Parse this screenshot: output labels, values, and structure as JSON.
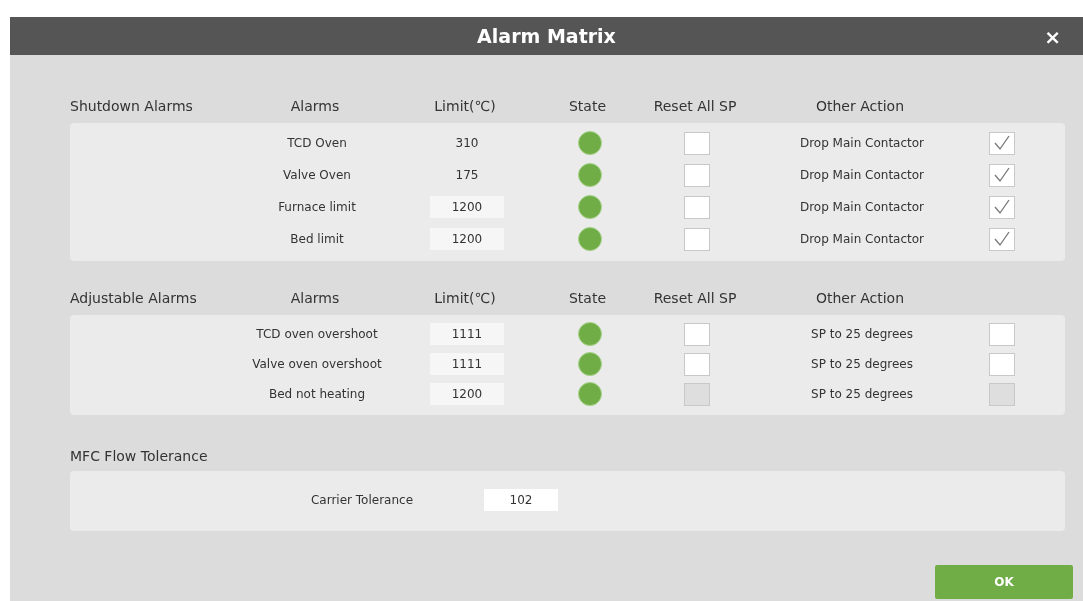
{
  "window": {
    "title": "Alarm Matrix",
    "close": "×"
  },
  "sections": [
    {
      "title": "Shutdown Alarms",
      "columns": [
        "Alarms",
        "Limit(℃)",
        "State",
        "Reset All SP",
        "Other Action"
      ],
      "rows": [
        {
          "alarm": "TCD Oven",
          "limit": {
            "kind": "text",
            "value": "310"
          },
          "on": true,
          "reset": {
            "checked": false,
            "disabled": false
          },
          "action": "Drop Main Contactor",
          "action_check": {
            "checked": true,
            "disabled": false
          }
        },
        {
          "alarm": "Valve Oven",
          "limit": {
            "kind": "text",
            "value": "175"
          },
          "on": true,
          "reset": {
            "checked": false,
            "disabled": false
          },
          "action": "Drop Main Contactor",
          "action_check": {
            "checked": true,
            "disabled": false
          }
        },
        {
          "alarm": "Furnace limit",
          "limit": {
            "kind": "field",
            "value": "1200"
          },
          "on": true,
          "reset": {
            "checked": false,
            "disabled": false
          },
          "action": "Drop Main Contactor",
          "action_check": {
            "checked": true,
            "disabled": false
          }
        },
        {
          "alarm": "Bed limit",
          "limit": {
            "kind": "field",
            "value": "1200"
          },
          "on": true,
          "reset": {
            "checked": false,
            "disabled": false
          },
          "action": "Drop Main Contactor",
          "action_check": {
            "checked": true,
            "disabled": false
          }
        }
      ]
    },
    {
      "title": "Adjustable Alarms",
      "columns": [
        "Alarms",
        "Limit(℃)",
        "State",
        "Reset All SP",
        "Other Action"
      ],
      "rows": [
        {
          "alarm": "TCD oven overshoot",
          "limit": {
            "kind": "field",
            "value": "1111"
          },
          "on": true,
          "reset": {
            "checked": false,
            "disabled": false
          },
          "action": "SP to 25 degrees",
          "action_check": {
            "checked": false,
            "disabled": false
          }
        },
        {
          "alarm": "Valve oven overshoot",
          "limit": {
            "kind": "field",
            "value": "1111"
          },
          "on": true,
          "reset": {
            "checked": false,
            "disabled": false
          },
          "action": "SP to 25 degrees",
          "action_check": {
            "checked": false,
            "disabled": false
          }
        },
        {
          "alarm": "Bed not heating",
          "limit": {
            "kind": "field",
            "value": "1200"
          },
          "on": true,
          "reset": {
            "checked": false,
            "disabled": true
          },
          "action": "SP to 25 degrees",
          "action_check": {
            "checked": false,
            "disabled": true
          }
        }
      ]
    }
  ],
  "flow": {
    "title": "MFC Flow Tolerance",
    "label": "Carrier Tolerance",
    "value": "102"
  },
  "ok_button": "OK"
}
